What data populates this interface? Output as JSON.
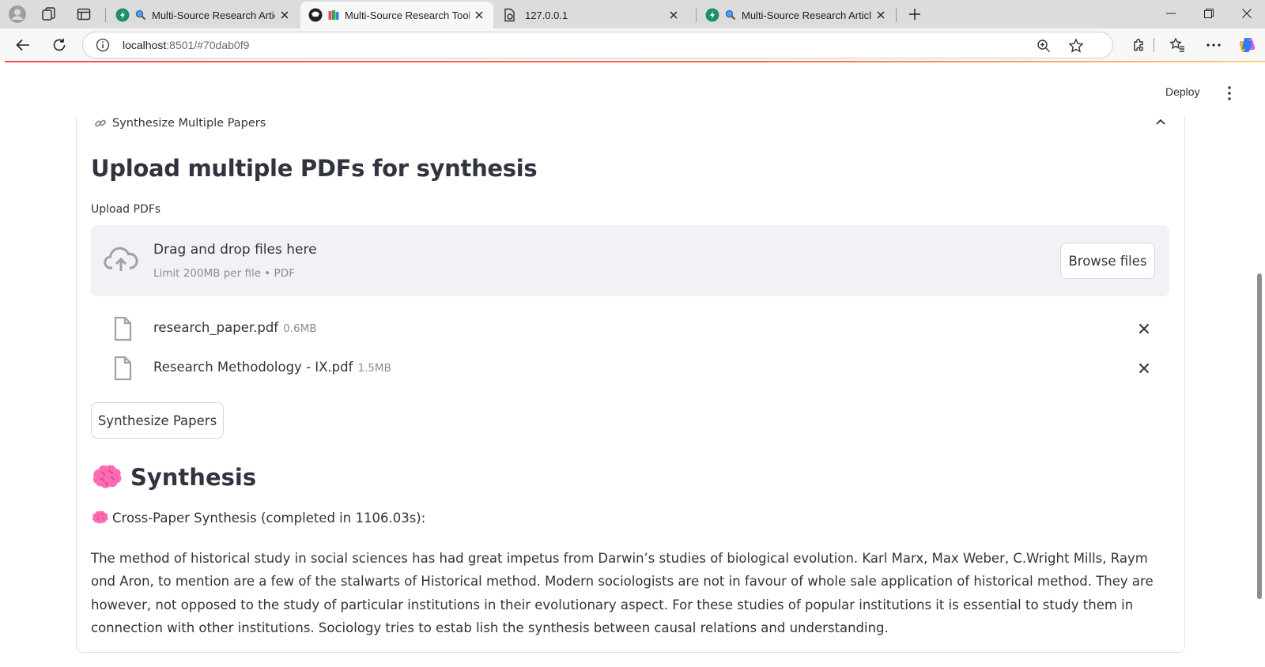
{
  "browser": {
    "tabs": [
      {
        "title": "Multi-Source Research Article",
        "active": false
      },
      {
        "title": "Multi-Source Research Tool",
        "active": true
      },
      {
        "title": "127.0.0.1",
        "active": false
      },
      {
        "title": "Multi-Source Research Article",
        "active": false
      }
    ],
    "address": {
      "host": "localhost",
      "rest": ":8501/#70dab0f9"
    }
  },
  "header": {
    "deploy_label": "Deploy"
  },
  "expander": {
    "title": "Synthesize Multiple Papers"
  },
  "uploader": {
    "heading": "Upload multiple PDFs for synthesis",
    "label": "Upload PDFs",
    "drop_title": "Drag and drop files here",
    "limit_text": "Limit 200MB per file • PDF",
    "browse_label": "Browse files",
    "files": [
      {
        "name": "research_paper.pdf",
        "size": "0.6MB"
      },
      {
        "name": "Research Methodology - IX.pdf",
        "size": "1.5MB"
      }
    ]
  },
  "actions": {
    "synthesize_label": "Synthesize Papers"
  },
  "synthesis": {
    "heading": "Synthesis",
    "subheading": "Cross-Paper Synthesis (completed in 1106.03s):",
    "body": "The method of historical study in social sciences has had great impetus from Darwin’s studies of biological evolution. Karl Marx, Max Weber, C.Wright Mills, Raym ond Aron, to mention are a few of the stalwarts of Historical method. Modern sociologists are not in favour of whole sale application of historical method. They are however, not opposed to the study of particular institutions in their evolutionary aspect. For these studies of popular institutions it is essential to study them in connection with other institutions. Sociology tries to estab lish the synthesis between causal relations and understanding."
  },
  "colors": {
    "text": "#31333f",
    "muted": "#8a8d96",
    "dropzone_bg": "#f0f2f6",
    "accent": "#ff4b4b",
    "brain": "#ff5fa8"
  }
}
